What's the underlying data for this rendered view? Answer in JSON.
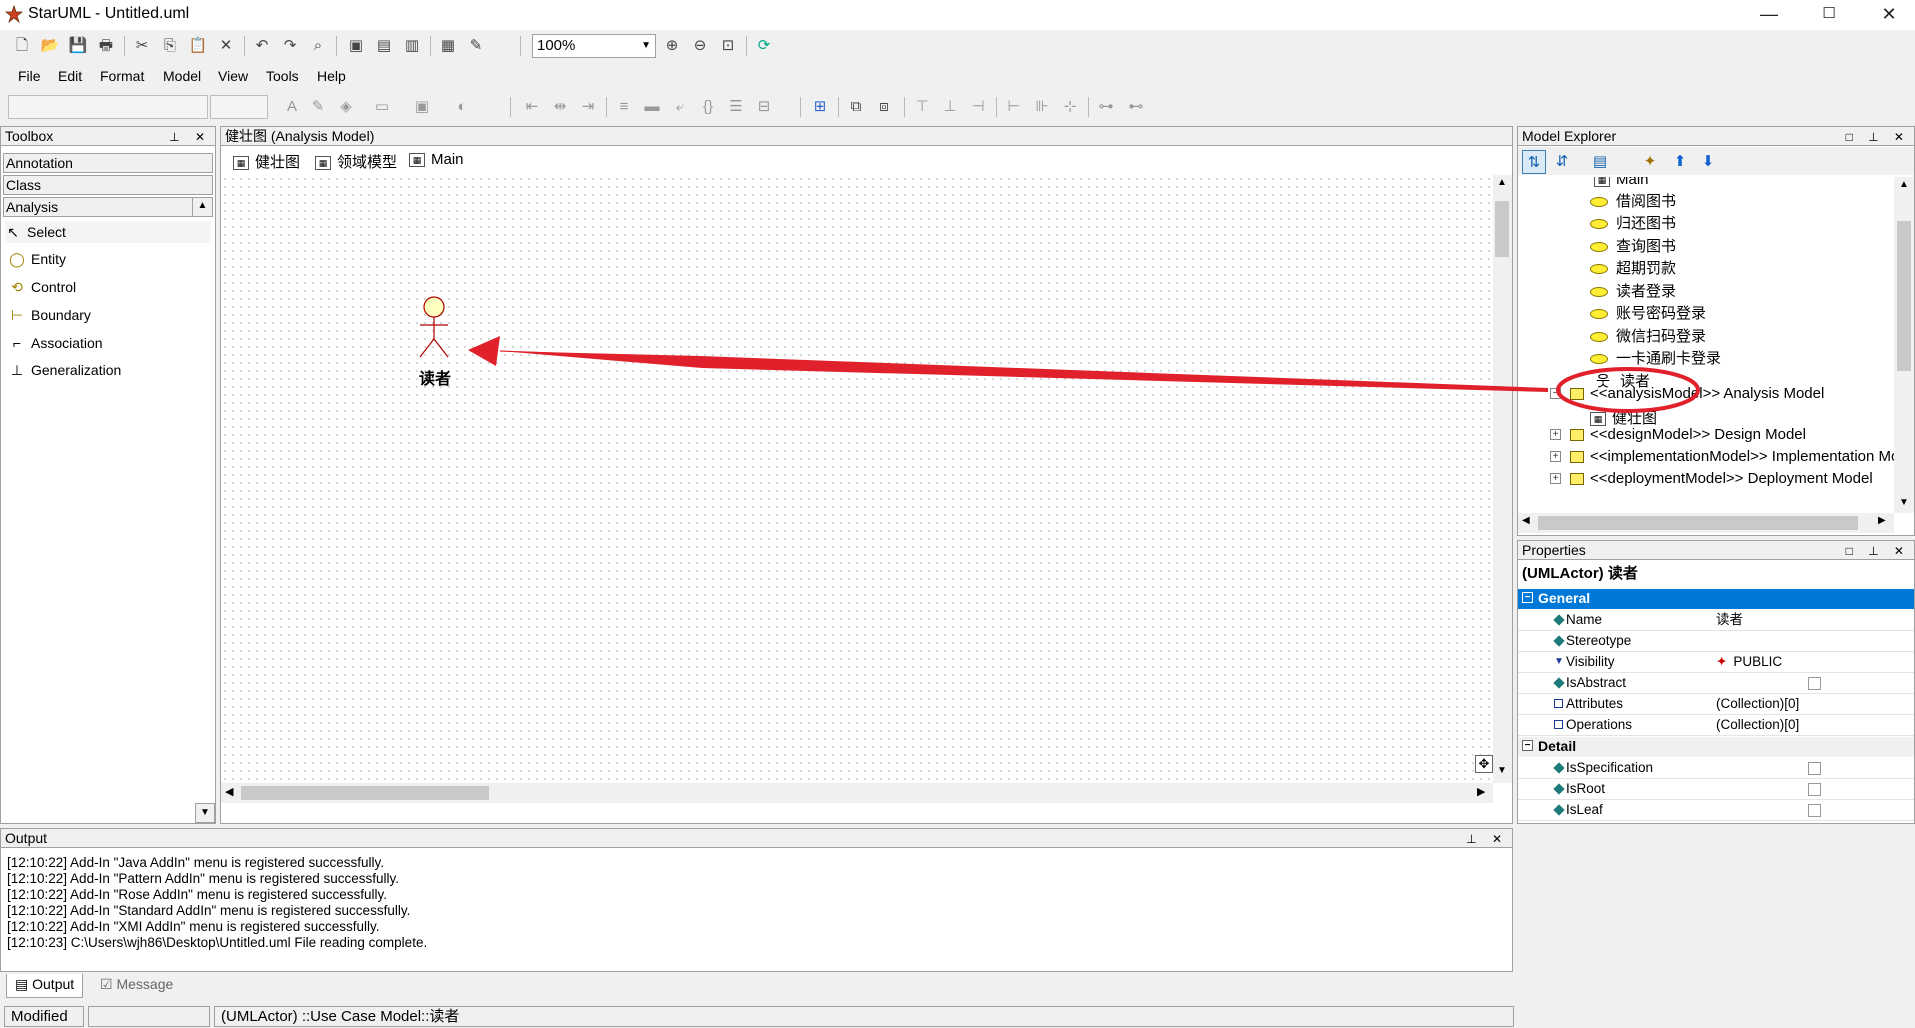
{
  "window": {
    "title": "StarUML - Untitled.uml",
    "min": "—",
    "max": "☐",
    "close": "✕"
  },
  "toolbar": {
    "zoom": "100%"
  },
  "menu": [
    "File",
    "Edit",
    "Format",
    "Model",
    "View",
    "Tools",
    "Help"
  ],
  "toolbox": {
    "title": "Toolbox",
    "categories": [
      "Annotation",
      "Class",
      "Analysis"
    ],
    "tools": [
      "Select",
      "Entity",
      "Control",
      "Boundary",
      "Association",
      "Generalization"
    ]
  },
  "diagram": {
    "header": "健壮图 (Analysis Model)",
    "tabs": [
      "健壮图",
      "领域模型",
      "Main"
    ],
    "actor_name": "读者"
  },
  "explorer": {
    "title": "Model Explorer",
    "items": [
      "Main",
      "借阅图书",
      "归还图书",
      "查询图书",
      "超期罚款",
      "读者登录",
      "账号密码登录",
      "微信扫码登录",
      "一卡通刷卡登录",
      "读者",
      "<<analysisModel>> Analysis Model",
      "健壮图",
      "<<designModel>> Design Model",
      "<<implementationModel>> Implementation Mode",
      "<<deploymentModel>> Deployment Model"
    ]
  },
  "properties": {
    "title": "Properties",
    "header": "(UMLActor) 读者",
    "general_label": "General",
    "detail_label": "Detail",
    "general": [
      {
        "name": "Name",
        "value": "读者"
      },
      {
        "name": "Stereotype",
        "value": ""
      },
      {
        "name": "Visibility",
        "value": "PUBLIC"
      },
      {
        "name": "IsAbstract",
        "value": ""
      },
      {
        "name": "Attributes",
        "value": "(Collection)[0]"
      },
      {
        "name": "Operations",
        "value": "(Collection)[0]"
      }
    ],
    "detail": [
      {
        "name": "IsSpecification",
        "value": ""
      },
      {
        "name": "IsRoot",
        "value": ""
      },
      {
        "name": "IsLeaf",
        "value": ""
      }
    ]
  },
  "output": {
    "title": "Output",
    "lines": [
      "[12:10:22]  Add-In \"Java AddIn\" menu is registered successfully.",
      "[12:10:22]  Add-In \"Pattern AddIn\" menu is registered successfully.",
      "[12:10:22]  Add-In \"Rose AddIn\" menu is registered successfully.",
      "[12:10:22]  Add-In \"Standard AddIn\" menu is registered successfully.",
      "[12:10:22]  Add-In \"XMI AddIn\" menu is registered successfully.",
      "[12:10:23]  C:\\Users\\wjh86\\Desktop\\Untitled.uml File reading complete."
    ],
    "tabs": [
      "Output",
      "Message"
    ]
  },
  "status": {
    "state": "Modified",
    "path": "(UMLActor) ::Use Case Model::读者"
  },
  "colors": {
    "selection": "#0078d7",
    "annotation": "#e0202a",
    "ellipse": "#ffee33"
  }
}
